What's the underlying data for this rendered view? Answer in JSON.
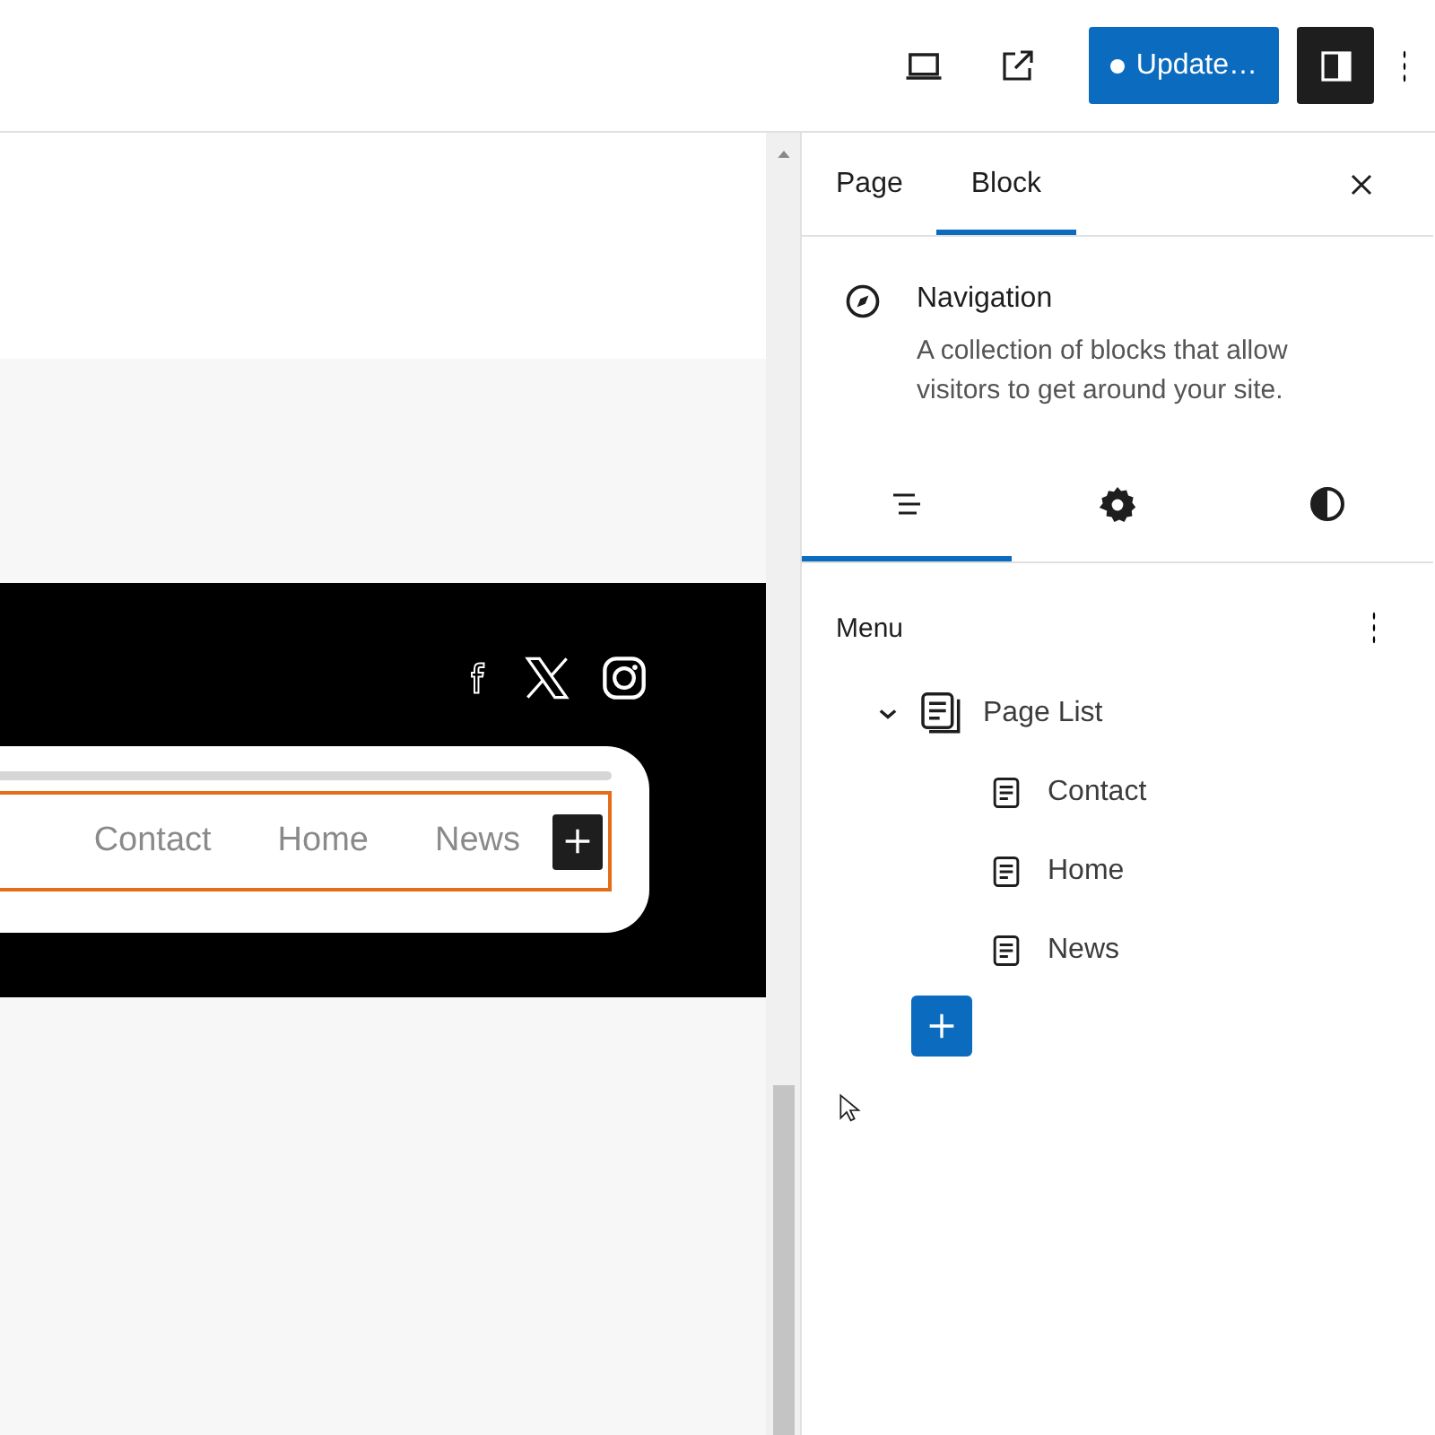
{
  "toolbar": {
    "update_button": {
      "label": "Update…",
      "unsaved": true
    },
    "sidebar_toggle": {
      "pressed": true
    }
  },
  "canvas": {
    "social_links": [
      {
        "kind": "facebook"
      },
      {
        "kind": "x"
      },
      {
        "kind": "instagram"
      }
    ],
    "navigation": {
      "selected": true,
      "items": [
        "Contact",
        "Home",
        "News"
      ]
    }
  },
  "sidebar": {
    "tabs": [
      {
        "label": "Page",
        "selected": false
      },
      {
        "label": "Block",
        "selected": true
      }
    ],
    "block": {
      "title": "Navigation",
      "description": "A collection of blocks that allow visitors to get around your site."
    },
    "inspector_tabs": [
      {
        "kind": "list",
        "selected": true
      },
      {
        "kind": "settings",
        "selected": false
      },
      {
        "kind": "styles",
        "selected": false
      }
    ],
    "menu": {
      "title": "Menu",
      "items": [
        {
          "label": "Page List",
          "kind": "page-list",
          "expanded": true,
          "children": [
            {
              "label": "Contact",
              "kind": "page"
            },
            {
              "label": "Home",
              "kind": "page"
            },
            {
              "label": "News",
              "kind": "page"
            }
          ]
        }
      ]
    }
  }
}
